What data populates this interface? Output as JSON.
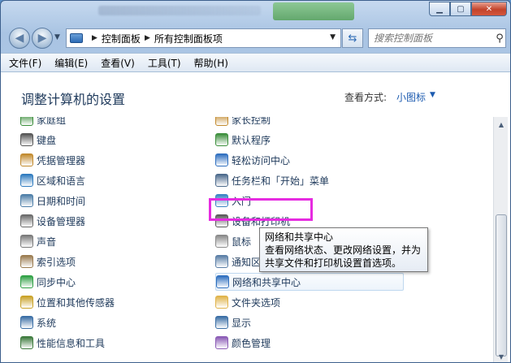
{
  "window": {
    "address": {
      "crumbs": [
        "控制面板",
        "所有控制面板项"
      ]
    },
    "search": {
      "placeholder": "搜索控制面板"
    }
  },
  "menu": [
    "文件(F)",
    "编辑(E)",
    "查看(V)",
    "工具(T)",
    "帮助(H)"
  ],
  "content": {
    "heading": "调整计算机的设置",
    "view_by_label": "查看方式:",
    "view_by_value": "小图标"
  },
  "items_left": [
    {
      "label": "家庭组",
      "icon": "homegroup-icon",
      "color": "#3a8d3a"
    },
    {
      "label": "键盘",
      "icon": "keyboard-icon",
      "color": "#555555"
    },
    {
      "label": "凭据管理器",
      "icon": "credential-icon",
      "color": "#c28a2e"
    },
    {
      "label": "区域和语言",
      "icon": "globe-icon",
      "color": "#2f7bbf"
    },
    {
      "label": "日期和时间",
      "icon": "clock-icon",
      "color": "#4d7ea8"
    },
    {
      "label": "设备管理器",
      "icon": "device-manager-icon",
      "color": "#6a6a6a"
    },
    {
      "label": "声音",
      "icon": "speaker-icon",
      "color": "#7a7a7a"
    },
    {
      "label": "索引选项",
      "icon": "index-icon",
      "color": "#9a7b4f"
    },
    {
      "label": "同步中心",
      "icon": "sync-icon",
      "color": "#2ea043"
    },
    {
      "label": "位置和其他传感器",
      "icon": "sensor-icon",
      "color": "#c9a227"
    },
    {
      "label": "系统",
      "icon": "system-icon",
      "color": "#3a6ea5"
    },
    {
      "label": "性能信息和工具",
      "icon": "performance-icon",
      "color": "#3c7a3c"
    }
  ],
  "items_right": [
    {
      "label": "家长控制",
      "icon": "parental-control-icon",
      "color": "#c28a2e"
    },
    {
      "label": "默认程序",
      "icon": "default-programs-icon",
      "color": "#3b8e3b"
    },
    {
      "label": "轻松访问中心",
      "icon": "accessibility-icon",
      "color": "#2f6fbf"
    },
    {
      "label": "任务栏和「开始」菜单",
      "icon": "taskbar-icon",
      "color": "#4c6a8c"
    },
    {
      "label": "入门",
      "icon": "getting-started-icon",
      "color": "#3a84c4"
    },
    {
      "label": "设备和打印机",
      "icon": "printer-icon",
      "color": "#5a5a5a"
    },
    {
      "label": "鼠标",
      "icon": "mouse-icon",
      "color": "#8a8a8a"
    },
    {
      "label": "通知区域图标",
      "icon": "notification-icon",
      "color": "#5a7ea6"
    },
    {
      "label": "网络和共享中心",
      "icon": "network-icon",
      "color": "#2f6fbf"
    },
    {
      "label": "文件夹选项",
      "icon": "folder-icon",
      "color": "#e0b34a"
    },
    {
      "label": "显示",
      "icon": "display-icon",
      "color": "#3a6ea5"
    },
    {
      "label": "颜色管理",
      "icon": "color-management-icon",
      "color": "#8a5ab5"
    }
  ],
  "tooltip": {
    "title": "网络和共享中心",
    "line1": "查看网络状态、更改网络设置，并为",
    "line2": "共享文件和打印机设置首选项。"
  }
}
